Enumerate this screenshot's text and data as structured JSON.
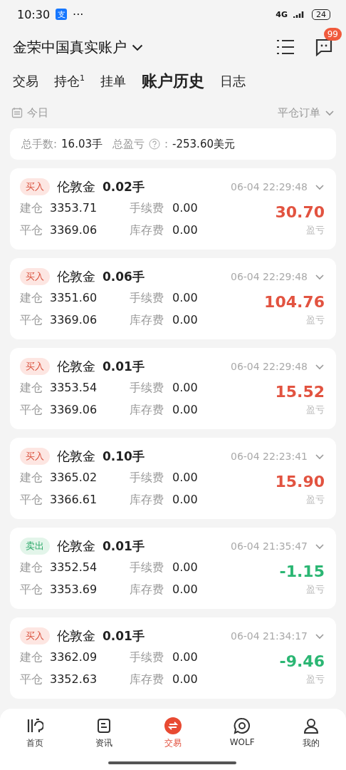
{
  "status_bar": {
    "time": "10:30",
    "app_icon": "支",
    "more": "···",
    "network": "4G",
    "battery": "24"
  },
  "header": {
    "account": "金荣中国真实账户",
    "badge": "99"
  },
  "tabs": [
    {
      "label": "交易",
      "selected": false
    },
    {
      "label": "持仓$^{1}$",
      "selected": false
    },
    {
      "label": "挂单",
      "selected": false
    },
    {
      "label": "账户历史",
      "selected": true
    },
    {
      "label": "日志",
      "selected": false
    }
  ],
  "filter": {
    "date": "今日",
    "type": "平仓订单"
  },
  "summary": {
    "lots_label": "总手数:",
    "lots": "16.03手",
    "pnl_label": "总盈亏",
    "pnl_sep": ":",
    "pnl": "-253.60美元"
  },
  "orders": [
    {
      "kind": "buy",
      "side_label": "买入",
      "symbol": "伦敦金",
      "lots": "0.02手",
      "time": "06-04 22:29:48",
      "open_label": "建仓",
      "open": "3353.71",
      "close_label": "平仓",
      "close": "3369.06",
      "fee_label": "手续费",
      "fee": "0.00",
      "swap_label": "库存费",
      "swap": "0.00",
      "pnl": {
        "kind": "gain",
        "value": "30.70",
        "label": "盈亏"
      }
    },
    {
      "kind": "buy",
      "side_label": "买入",
      "symbol": "伦敦金",
      "lots": "0.06手",
      "time": "06-04 22:29:48",
      "open_label": "建仓",
      "open": "3351.60",
      "close_label": "平仓",
      "close": "3369.06",
      "fee_label": "手续费",
      "fee": "0.00",
      "swap_label": "库存费",
      "swap": "0.00",
      "pnl": {
        "kind": "gain",
        "value": "104.76",
        "label": "盈亏"
      }
    },
    {
      "kind": "buy",
      "side_label": "买入",
      "symbol": "伦敦金",
      "lots": "0.01手",
      "time": "06-04 22:29:48",
      "open_label": "建仓",
      "open": "3353.54",
      "close_label": "平仓",
      "close": "3369.06",
      "fee_label": "手续费",
      "fee": "0.00",
      "swap_label": "库存费",
      "swap": "0.00",
      "pnl": {
        "kind": "gain",
        "value": "15.52",
        "label": "盈亏"
      }
    },
    {
      "kind": "buy",
      "side_label": "买入",
      "symbol": "伦敦金",
      "lots": "0.10手",
      "time": "06-04 22:23:41",
      "open_label": "建仓",
      "open": "3365.02",
      "close_label": "平仓",
      "close": "3366.61",
      "fee_label": "手续费",
      "fee": "0.00",
      "swap_label": "库存费",
      "swap": "0.00",
      "pnl": {
        "kind": "gain",
        "value": "15.90",
        "label": "盈亏"
      }
    },
    {
      "kind": "sell",
      "side_label": "卖出",
      "symbol": "伦敦金",
      "lots": "0.01手",
      "time": "06-04 21:35:47",
      "open_label": "建仓",
      "open": "3352.54",
      "close_label": "平仓",
      "close": "3353.69",
      "fee_label": "手续费",
      "fee": "0.00",
      "swap_label": "库存费",
      "swap": "0.00",
      "pnl": {
        "kind": "loss",
        "value": "-1.15",
        "label": "盈亏"
      }
    },
    {
      "kind": "buy",
      "side_label": "买入",
      "symbol": "伦敦金",
      "lots": "0.01手",
      "time": "06-04 21:34:17",
      "open_label": "建仓",
      "open": "3362.09",
      "close_label": "平仓",
      "close": "3352.63",
      "fee_label": "手续费",
      "fee": "0.00",
      "swap_label": "库存费",
      "swap": "0.00",
      "pnl": {
        "kind": "loss",
        "value": "-9.46",
        "label": "盈亏"
      }
    }
  ],
  "nav": [
    {
      "label": "首页",
      "kind": "home",
      "selected": false
    },
    {
      "label": "资讯",
      "kind": "news",
      "selected": false
    },
    {
      "label": "交易",
      "kind": "trade",
      "selected": true
    },
    {
      "label": "WOLF",
      "kind": "chat",
      "selected": false
    },
    {
      "label": "我的",
      "kind": "user",
      "selected": false
    }
  ]
}
